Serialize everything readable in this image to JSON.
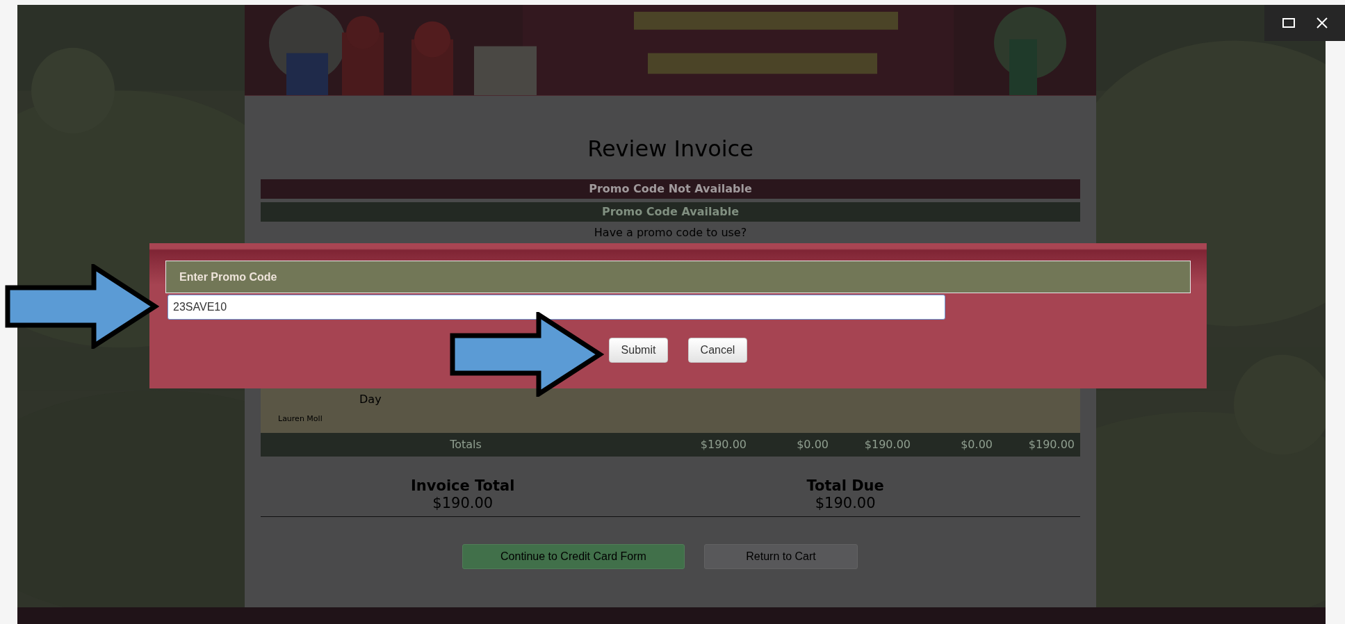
{
  "page": {
    "title": "Review Invoice",
    "promo_messages": [
      {
        "text": "Promo Code Not Available",
        "kind": "error"
      },
      {
        "text": "Promo Code Available",
        "kind": "success"
      }
    ],
    "promo_prompt": "Have a promo code to use?",
    "table": {
      "row_text": "Day",
      "participant": "Lauren Moll",
      "totals": {
        "label": "Totals",
        "values": [
          "$190.00",
          "$0.00",
          "$190.00",
          "$0.00",
          "$190.00"
        ]
      }
    },
    "summary": [
      {
        "label": "Invoice Total",
        "amount": "$190.00"
      },
      {
        "label": "Total Due",
        "amount": "$190.00"
      }
    ],
    "buttons": [
      {
        "label": "Continue to Credit Card Form",
        "kind": "primary"
      },
      {
        "label": "Return to Cart",
        "kind": "secondary"
      }
    ]
  },
  "modal": {
    "title": "Enter Promo Code",
    "input": {
      "value": "23SAVE10"
    },
    "buttons": [
      {
        "label": "Submit"
      },
      {
        "label": "Cancel"
      }
    ]
  }
}
